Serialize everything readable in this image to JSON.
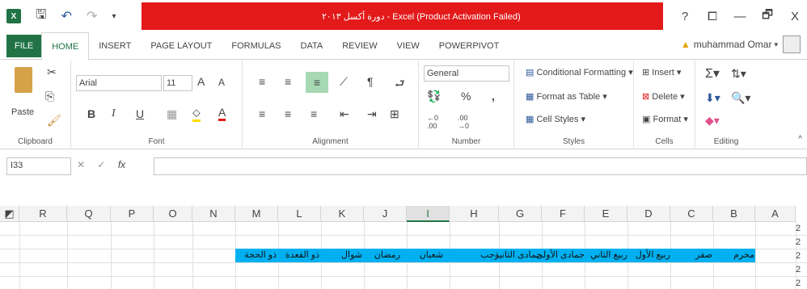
{
  "titlebar": {
    "app_icon": "excel-icon",
    "title": "دورة أكسل ٢٠١٣ - Excel (Product Activation Failed)",
    "help": "?",
    "ribbon_display": "⧠",
    "minimize": "—",
    "restore": "🗗",
    "close": "X",
    "accent": "#e3191a"
  },
  "tabs": [
    "FILE",
    "HOME",
    "INSERT",
    "PAGE LAYOUT",
    "FORMULAS",
    "DATA",
    "REVIEW",
    "VIEW",
    "POWERPIVOT"
  ],
  "user": {
    "name": "muhammad Omar"
  },
  "ribbon": {
    "clipboard": {
      "label": "Clipboard",
      "paste": "Paste"
    },
    "font": {
      "label": "Font",
      "name": "Arial",
      "size": "11",
      "grow": "A",
      "shrink": "A",
      "bold": "B",
      "italic": "I",
      "underline": "U",
      "color": "A"
    },
    "alignment": {
      "label": "Alignment"
    },
    "number": {
      "label": "Number",
      "format": "General",
      "percent": "%",
      "comma": ",",
      "inc_dec": "←0 .00",
      "dec_dec": ".00 →0"
    },
    "styles": {
      "label": "Styles",
      "conditional": "Conditional Formatting",
      "table": "Format as Table",
      "cell_styles": "Cell Styles"
    },
    "cells": {
      "label": "Cells",
      "insert": "Insert",
      "delete": "Delete",
      "format": "Format"
    },
    "editing": {
      "label": "Editing"
    }
  },
  "formula_bar": {
    "name_box": "I33",
    "cancel": "✕",
    "enter": "✓",
    "fx": "fx",
    "value": ""
  },
  "columns": [
    "R",
    "Q",
    "P",
    "O",
    "N",
    "M",
    "L",
    "K",
    "J",
    "I",
    "H",
    "G",
    "F",
    "E",
    "D",
    "C",
    "B",
    "A"
  ],
  "selected_column": "I",
  "months": [
    "محرم",
    "صفر",
    "ربيع الأول",
    "ربيع الثاني",
    "جمادى الأولى",
    "جمادى الثانية",
    "رجب",
    "شعبان",
    "رمضان",
    "شوال",
    "ذو القعدة",
    "ذو الحجة"
  ],
  "row_numbers": [
    "2",
    "2",
    "2",
    "2",
    "2",
    "2"
  ],
  "colors": {
    "excel_green": "#217346",
    "cell_fill": "#00b0f0"
  }
}
